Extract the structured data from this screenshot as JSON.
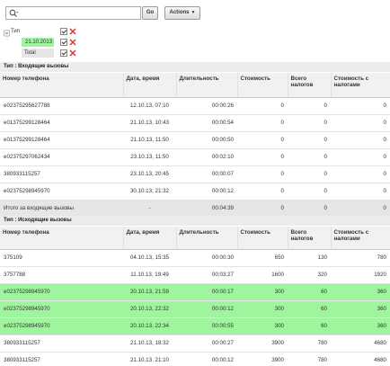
{
  "toolbar": {
    "search_value": "",
    "go_label": "Go",
    "actions_label": "Actions"
  },
  "filters": {
    "root_label": "Тип",
    "items": [
      {
        "label": "21.10.2013",
        "highlight": "#9ef59e"
      },
      {
        "label": "Total",
        "highlight": "#e6e6e6"
      }
    ]
  },
  "incoming": {
    "title": "Тип : Входящие вызовы",
    "columns": [
      "Номер телефона",
      "Дата, время",
      "Длительность",
      "Стоимость",
      "Всего налогов",
      "Стоимость с налогами"
    ],
    "rows": [
      [
        "e02375295627788",
        "12.10.13, 07:10",
        "00:00:26",
        "0",
        "0",
        "0"
      ],
      [
        "e01375299128464",
        "21.10.13, 10:43",
        "00:00:54",
        "0",
        "0",
        "0"
      ],
      [
        "e01375299128464",
        "21.10.13, 11:50",
        "00:00:50",
        "0",
        "0",
        "0"
      ],
      [
        "e02375297062434",
        "23.10.13, 11:50",
        "00:02:10",
        "0",
        "0",
        "0"
      ],
      [
        "380933115257",
        "23.10.13, 20:45",
        "00:00:07",
        "0",
        "0",
        "0"
      ],
      [
        "e02375298945970",
        "30.10.13, 21:32",
        "00:00:12",
        "0",
        "0",
        "0"
      ]
    ],
    "total": [
      "Итого за входящие вызовы",
      "-",
      "00:04:39",
      "0",
      "0",
      "0"
    ]
  },
  "outgoing": {
    "title": "Тип : Исходящие вызовы",
    "columns": [
      "Номер телефона",
      "Дата, время",
      "Длительность",
      "Стоимость",
      "Всего налогов",
      "Стоимость с налогами"
    ],
    "rows": [
      [
        "375109",
        "04.10.13, 15:35",
        "00:00:30",
        "650",
        "130",
        "780"
      ],
      [
        "3757788",
        "11.10.13, 19:49",
        "00:03:27",
        "1600",
        "320",
        "1920"
      ],
      [
        "e02375298945970",
        "20.10.13, 21:59",
        "00:00:17",
        "300",
        "60",
        "360"
      ],
      [
        "e02375298945970",
        "20.10.13, 22:32",
        "00:00:12",
        "300",
        "60",
        "360"
      ],
      [
        "e02375298945970",
        "20.10.13, 22:34",
        "00:00:55",
        "300",
        "60",
        "360"
      ],
      [
        "380933115257",
        "21.10.13, 18:32",
        "00:00:27",
        "3900",
        "780",
        "4680"
      ],
      [
        "380933115257",
        "21.10.13, 21:10",
        "00:00:12",
        "3900",
        "780",
        "4680"
      ]
    ],
    "highlighted_rows": [
      2,
      3,
      4
    ]
  },
  "colors": {
    "highlight": "#9ef59e",
    "total_row": "#e6e6e6",
    "delete_icon": "#dd3333"
  }
}
